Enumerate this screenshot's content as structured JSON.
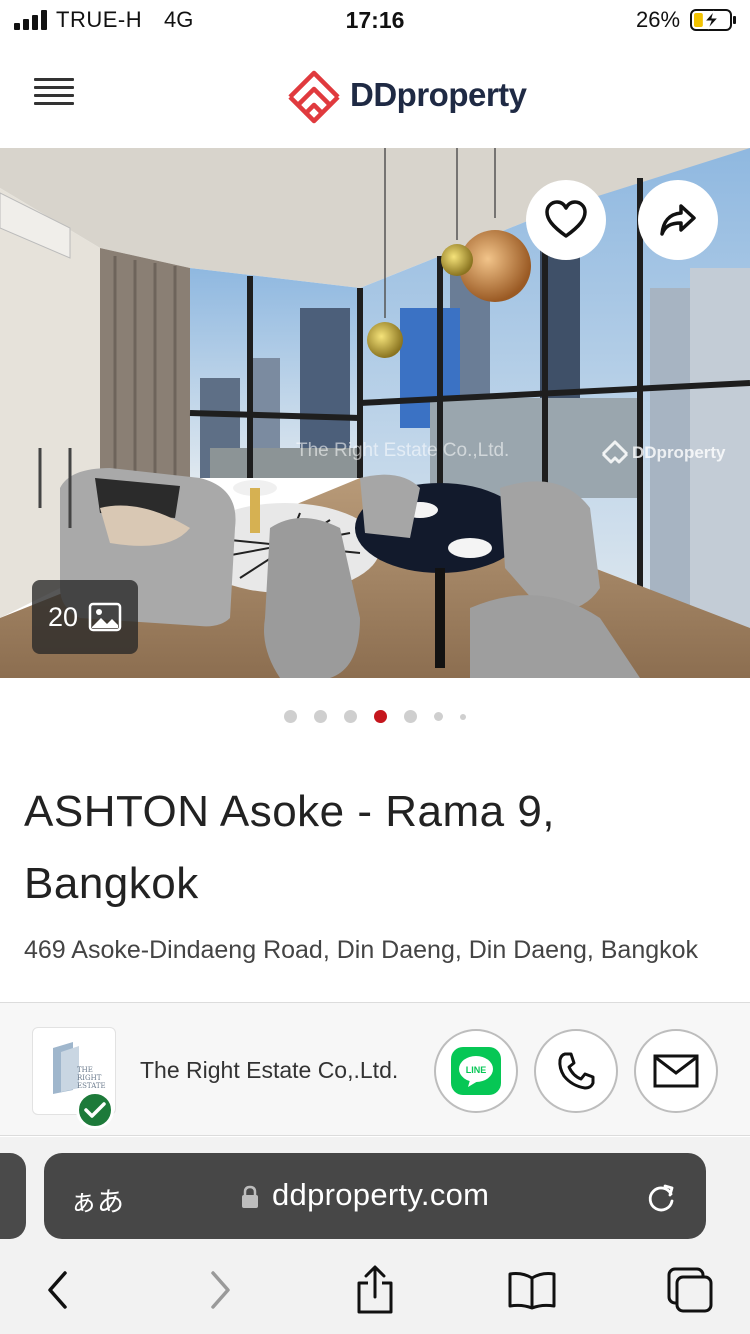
{
  "status_bar": {
    "carrier": "TRUE-H",
    "network": "4G",
    "time": "17:16",
    "battery_percent": "26%",
    "battery_level": 0.26
  },
  "header": {
    "logo_text": "DDproperty",
    "brand_color": "#e03a3e"
  },
  "gallery": {
    "photo_count": "20",
    "agent_watermark": "The Right Estate Co.,Ltd.",
    "logo_watermark": "DDproperty",
    "dot_count": 7,
    "active_dot_index": 3
  },
  "listing": {
    "title": "ASHTON Asoke - Rama 9, Bangkok",
    "address": "469 Asoke-Dindaeng Road, Din Daeng, Din Daeng, Bangkok"
  },
  "agent": {
    "name": "The Right Estate Co,.Ltd.",
    "verified": true,
    "line_label": "LINE"
  },
  "browser": {
    "text_size_label": "ぁあ",
    "url": "ddproperty.com"
  },
  "colors": {
    "active_dot": "#c5161d",
    "verified_badge": "#1d7a3a",
    "line_green": "#06c755"
  }
}
